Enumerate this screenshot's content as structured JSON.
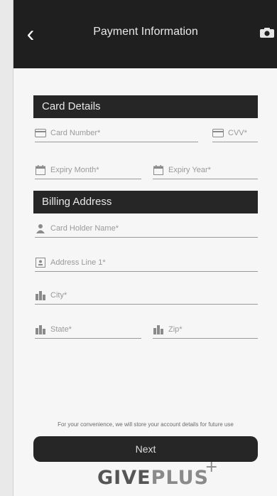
{
  "header": {
    "title": "Payment Information",
    "back_icon": "chevron-left-icon",
    "camera_icon": "camera-icon"
  },
  "card_details": {
    "heading": "Card Details",
    "card_number_placeholder": "Card Number*",
    "cvv_placeholder": "CVV*",
    "expiry_month_placeholder": "Expiry Month*",
    "expiry_year_placeholder": "Expiry Year*"
  },
  "billing": {
    "heading": "Billing Address",
    "card_holder_placeholder": "Card Holder Name*",
    "address_line_placeholder": "Address Line 1*",
    "city_placeholder": "City*",
    "state_placeholder": "State*",
    "zip_placeholder": "Zip*"
  },
  "footer": {
    "notice": "For your convenience, we will store your account details for future use",
    "next_label": "Next",
    "logo_give": "GIVE",
    "logo_plus": "PLUS",
    "logo_cross": "+"
  }
}
